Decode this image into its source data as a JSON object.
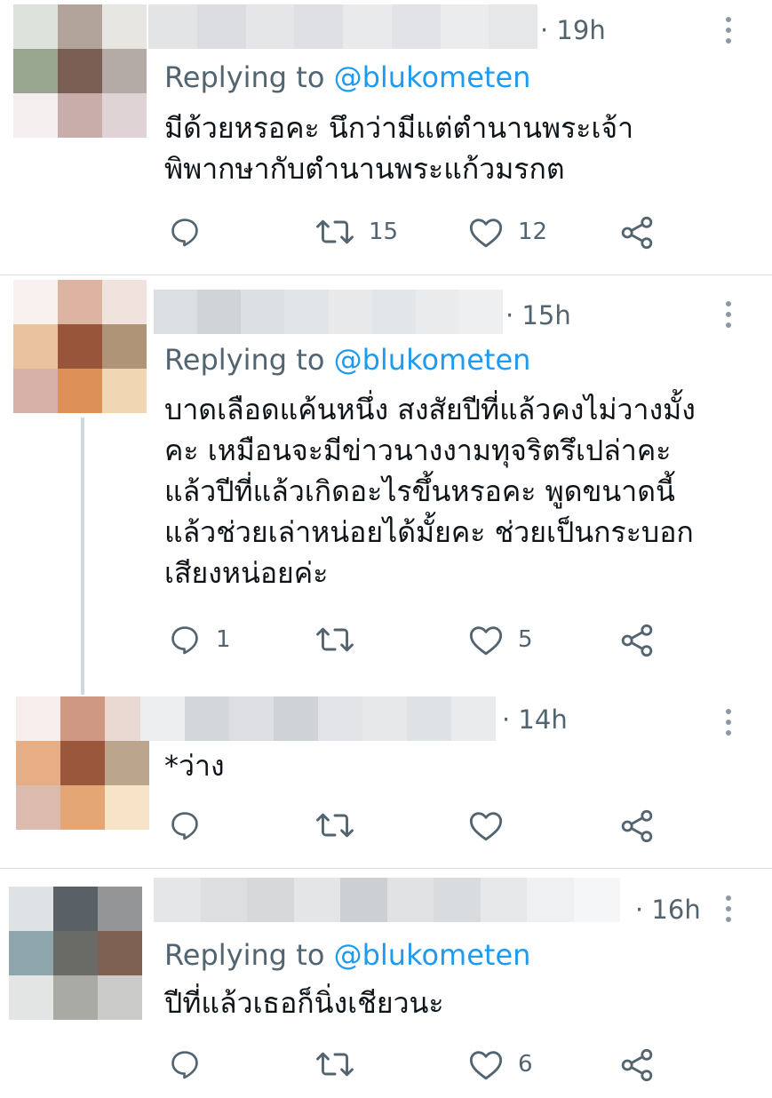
{
  "tweets": [
    {
      "time": "· 19h",
      "reply_prefix": "Replying to ",
      "reply_handle": "@blukometen",
      "lines": [
        "มีด้วยหรอคะ นึกว่ามีแต่ตำนานพระเจ้า",
        "พิพากษากับตำนานพระแก้วมรกต"
      ],
      "reply_count": "",
      "retweet_count": "15",
      "like_count": "12",
      "avatar_colors": [
        "#dde3dc",
        "#b2a49b",
        "#e8e6e2",
        "#98a690",
        "#7b5f55",
        "#b4aba6",
        "#f5eeee",
        "#c8adab",
        "#e0d3d6"
      ]
    },
    {
      "time": "· 15h",
      "reply_prefix": "Replying to ",
      "reply_handle": "@blukometen",
      "lines": [
        "บาดเลือดแค้นหนึ่ง สงสัยปีที่แล้วคงไม่วางมั้ง",
        "คะ เหมือนจะมีข่าวนางงามทุจริตรึเปล่าคะ",
        "แล้วปีที่แล้วเกิดอะไรขึ้นหรอคะ พูดขนาดนี้",
        "แล้วช่วยเล่าหน่อยได้มั้ยคะ ช่วยเป็นกระบอก",
        "เสียงหน่อยค่ะ"
      ],
      "reply_count": "1",
      "retweet_count": "",
      "like_count": "5",
      "avatar_colors": [
        "#f8f1ef",
        "#ddb3a2",
        "#f0e2dd",
        "#e9c3a0",
        "#99553a",
        "#b09477",
        "#d7b1a7",
        "#dd9159",
        "#f1d6b4"
      ]
    },
    {
      "time": "· 14h",
      "reply_prefix": "",
      "reply_handle": "",
      "lines": [
        "*ว่าง"
      ],
      "reply_count": "",
      "retweet_count": "",
      "like_count": "",
      "avatar_colors": [
        "#f7eeeb",
        "#cf9882",
        "#ead8d2",
        "#e7ad84",
        "#9a573b",
        "#bba68d",
        "#dcbbaf",
        "#e5a676",
        "#f6e3c8"
      ]
    },
    {
      "time": "· 16h",
      "reply_prefix": "Replying to ",
      "reply_handle": "@blukometen",
      "lines": [
        "ปีที่แล้วเธอก็นิ่งเชียวนะ"
      ],
      "reply_count": "",
      "retweet_count": "",
      "like_count": "6",
      "avatar_colors": [
        "#dfe2e4",
        "#5a6166",
        "#939597",
        "#8ea5ab",
        "#6a6b67",
        "#7e6153",
        "#e3e5e5",
        "#a9aaa3",
        "#cbcbc9"
      ]
    }
  ],
  "icons": {
    "reply": "reply-icon",
    "retweet": "retweet-icon",
    "like": "heart-icon",
    "share": "share-icon",
    "more": "more-icon"
  }
}
